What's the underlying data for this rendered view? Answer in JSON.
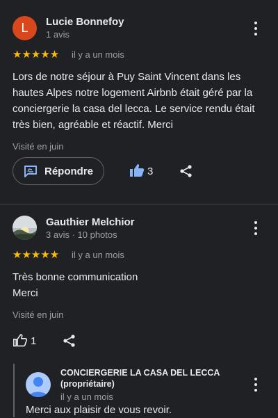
{
  "reviews": [
    {
      "avatar_letter": "L",
      "author": "Lucie Bonnefoy",
      "meta": "1 avis",
      "stars": "★★★★★",
      "rating": 5,
      "date": "il y a un mois",
      "text_lines": [
        "Lors de notre séjour à Puy Saint Vincent dans les",
        "hautes Alpes notre logement Airbnb était géré par la",
        "conciergerie la casa del lecca. Le service rendu était",
        "très bien, agréable et réactif. Merci"
      ],
      "visited": "Visité en juin",
      "reply_label": "Répondre",
      "likes": "3"
    },
    {
      "author": "Gauthier Melchior",
      "meta": "3 avis · 10 photos",
      "stars": "★★★★★",
      "rating": 5,
      "date": "il y a un mois",
      "text_lines": [
        "Très bonne communication",
        "Merci"
      ],
      "visited": "Visité en juin",
      "likes": "1"
    }
  ],
  "owner_reply": {
    "name_line1": "CONCIERGERIE LA CASA DEL LECCA",
    "name_line2": "(propriétaire)",
    "date": "il y a un mois",
    "text": "Merci aux plaisir de vous revoir."
  },
  "colors": {
    "star": "#fbbc04",
    "accent": "#8ab4f8",
    "avatar": "#d9481d",
    "background": "#202124"
  }
}
